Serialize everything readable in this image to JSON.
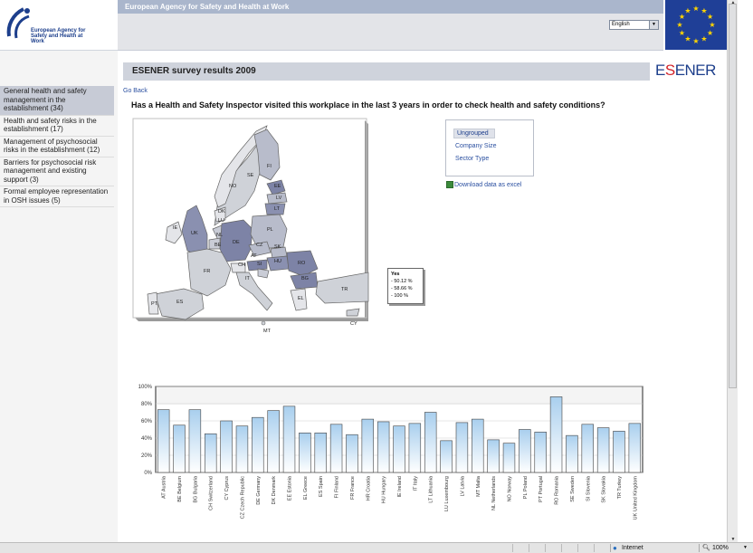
{
  "header": {
    "logo_text": "European Agency for Safety and Health at Work",
    "agency_title": "European Agency for Safety and Health at Work",
    "language": "English",
    "flag_icon": "eu-flag-icon"
  },
  "sidebar": {
    "items": [
      {
        "label": "General health and safety management in the establishment (34)",
        "active": true
      },
      {
        "label": "Health and safety risks in the establishment (17)",
        "active": false
      },
      {
        "label": "Management of psychosocial risks in the establishment (12)",
        "active": false
      },
      {
        "label": "Barriers for psychosocial risk management and existing support (3)",
        "active": false
      },
      {
        "label": "Formal employee representation in OSH issues (5)",
        "active": false
      }
    ]
  },
  "main": {
    "section_title": "ESENER survey results 2009",
    "logo": {
      "prefix": "E",
      "accent": "S",
      "suffix": "ENER"
    },
    "go_back": "Go Back",
    "question": "Has a Health and Safety Inspector visited this workplace in the last 3 years in order to check health and safety conditions?",
    "group_options": [
      "Ungrouped",
      "Company Size",
      "Sector Type"
    ],
    "selected_group": "Ungrouped",
    "download_label": "Download data as excel",
    "map": {
      "legend_title": "Yes",
      "legend_items": [
        "- 50.12 %",
        "- 58.66 %",
        "- 100 %"
      ],
      "country_labels": [
        "FI",
        "SE",
        "NO",
        "EE",
        "LV",
        "LT",
        "DK",
        "IE",
        "UK",
        "LU",
        "NL",
        "BE",
        "DE",
        "PL",
        "CZ",
        "SK",
        "HU",
        "RO",
        "AT",
        "SI",
        "FR",
        "CH",
        "IT",
        "BG",
        "ES",
        "PT",
        "EL",
        "TR",
        "MT",
        "CY"
      ]
    }
  },
  "chart_data": {
    "type": "bar",
    "categories": [
      "AT Austria",
      "BE Belgium",
      "BG Bulgaria",
      "CH Switzerland",
      "CY Cyprus",
      "CZ Czech Republic",
      "DE Germany",
      "DK Denmark",
      "EE Estonia",
      "EL Greece",
      "ES Spain",
      "FI Finland",
      "FR France",
      "HR Croatia",
      "HU Hungary",
      "IE Ireland",
      "IT Italy",
      "LT Lithuania",
      "LU Luxembourg",
      "LV Latvia",
      "MT Malta",
      "NL Netherlands",
      "NO Norway",
      "PL Poland",
      "PT Portugal",
      "RO Romania",
      "SE Sweden",
      "SI Slovenia",
      "SK Slovakia",
      "TR Turkey",
      "UK United Kingdom"
    ],
    "values": [
      73,
      55,
      73,
      45,
      60,
      54,
      64,
      72,
      77,
      46,
      46,
      56,
      44,
      62,
      59,
      54,
      57,
      70,
      37,
      58,
      62,
      38,
      34,
      50,
      47,
      88,
      43,
      56,
      52,
      48,
      57
    ],
    "yticks": [
      "0%",
      "20%",
      "40%",
      "60%",
      "80%",
      "100%"
    ],
    "ylim": [
      0,
      100
    ],
    "bar_color": "#a9cfee",
    "grid": true
  },
  "statusbar": {
    "zone": "Internet",
    "zoom": "100%"
  }
}
